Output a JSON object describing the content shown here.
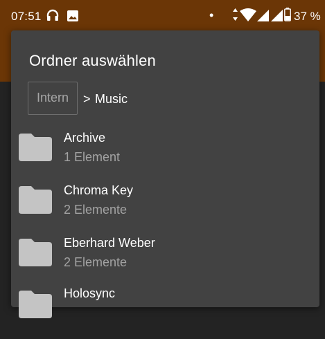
{
  "status_bar": {
    "time": "07:51",
    "battery_percent": "37 %",
    "icons": [
      "headphones-icon",
      "image-icon",
      "dot-icon",
      "data-arrows-icon",
      "wifi-icon",
      "signal-icon",
      "signal-icon",
      "battery-icon"
    ]
  },
  "dialog": {
    "title": "Ordner auswählen",
    "breadcrumb": {
      "root": "Intern",
      "separator": ">",
      "current": "Music"
    },
    "folders": [
      {
        "name": "Archive",
        "count": "1 Element"
      },
      {
        "name": "Chroma Key",
        "count": "2 Elemente"
      },
      {
        "name": "Eberhard Weber",
        "count": "2 Elemente"
      },
      {
        "name": "Holosync",
        "count": ""
      }
    ]
  },
  "colors": {
    "status_bar": "#6b3606",
    "dialog_background": "#424242",
    "page_background": "#232323",
    "folder_icon": "#c4c4c4"
  }
}
